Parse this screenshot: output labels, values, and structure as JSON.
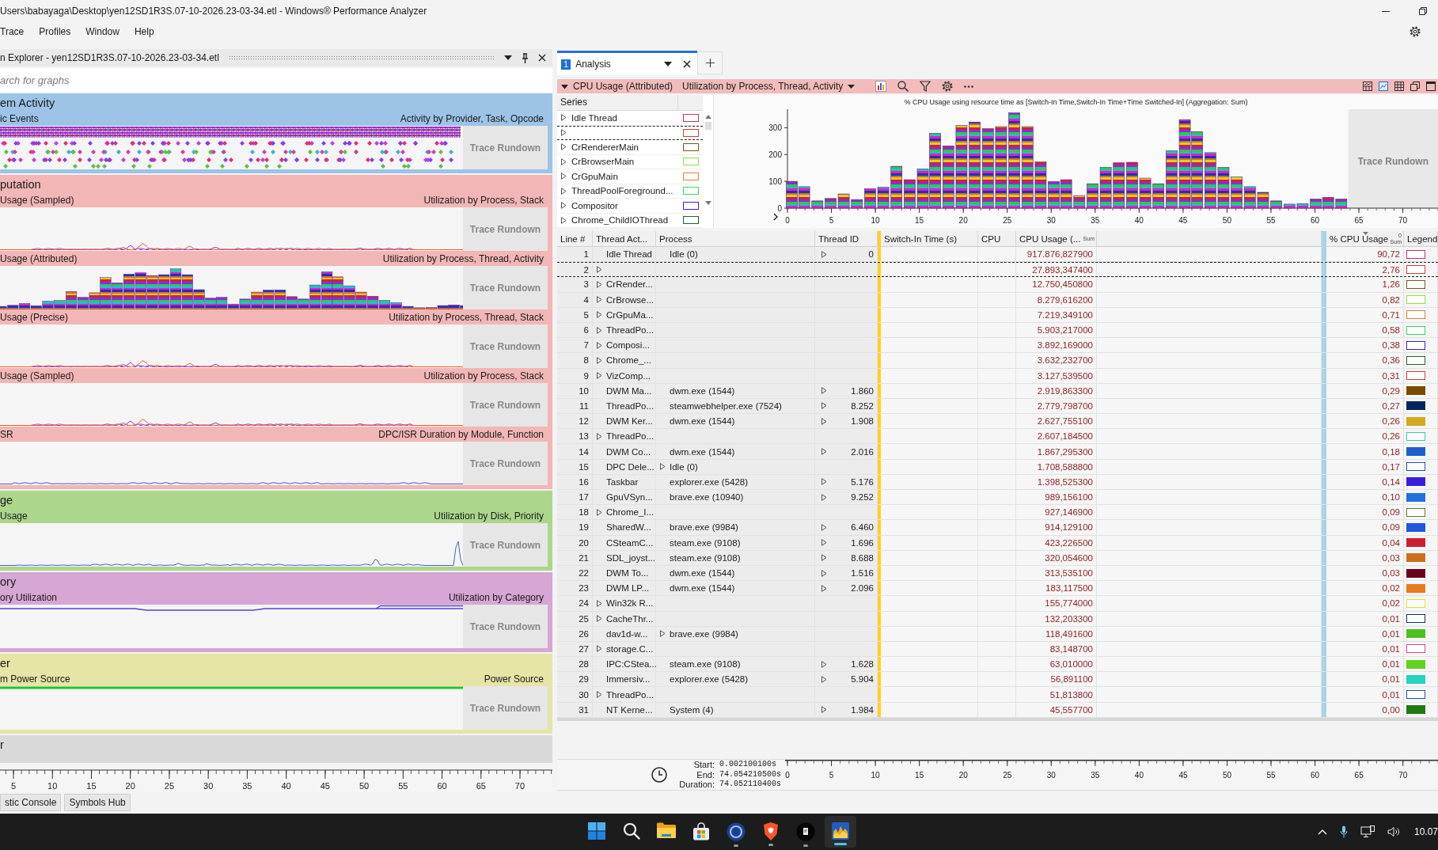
{
  "window": {
    "title": "Users\\babayaga\\Desktop\\yen12SD1R3S.07-10-2026.23-03-34.etl - Windows® Performance Analyzer"
  },
  "menu": [
    "Trace",
    "Profiles",
    "Window",
    "Help"
  ],
  "graph_explorer": {
    "title": "n Explorer - yen12SD1R3S.07-10-2026.23-03-34.etl",
    "search": {
      "placeholder": "arch for graphs"
    },
    "groups": [
      {
        "title": "em Activity",
        "color": "#9dc3e6",
        "graphs": [
          {
            "name": "ic Events",
            "preset": "Activity by Provider, Task, Opcode",
            "kind": "events",
            "rundown": "Trace Rundown"
          }
        ]
      },
      {
        "title": "putation",
        "color": "#f2b6b6",
        "graphs": [
          {
            "name": "Usage (Sampled)",
            "preset": "Utilization by Process, Stack",
            "kind": "lines",
            "rundown": "Trace Rundown"
          },
          {
            "name": "Usage (Attributed)",
            "preset": "Utilization by Process, Thread, Activity",
            "kind": "stacked",
            "rundown": "Trace Rundown"
          },
          {
            "name": "Usage (Precise)",
            "preset": "Utilization by Process, Thread, Stack",
            "kind": "lines",
            "rundown": "Trace Rundown"
          },
          {
            "name": "Usage (Sampled)",
            "preset": "Utilization by Process, Stack",
            "kind": "lines",
            "rundown": "Trace Rundown"
          },
          {
            "name": "SR",
            "preset": "DPC/ISR Duration by Module, Function",
            "kind": "dpc",
            "rundown": "Trace Rundown"
          }
        ]
      },
      {
        "title": "ge",
        "color": "#acd68c",
        "graphs": [
          {
            "name": "Usage",
            "preset": "Utilization by Disk, Priority",
            "kind": "spike",
            "rundown": "Trace Rundown"
          }
        ]
      },
      {
        "title": "ory",
        "color": "#d6a6d4",
        "graphs": [
          {
            "name": "ory Utilization",
            "preset": "Utilization by Category",
            "kind": "flat",
            "rundown": "Trace Rundown"
          }
        ]
      },
      {
        "title": "er",
        "color": "#e6e4a6",
        "graphs": [
          {
            "name": "m Power Source",
            "preset": "Power Source",
            "kind": "power",
            "rundown": "Trace Rundown"
          }
        ]
      },
      {
        "title": "r",
        "color": "#d9d9d9"
      }
    ],
    "timeline_ticks": [
      "5",
      "10",
      "15",
      "20",
      "25",
      "30",
      "35",
      "40",
      "45",
      "50",
      "55",
      "60",
      "65",
      "70"
    ]
  },
  "bottom_tabs": [
    "stic Console",
    "Symbols Hub"
  ],
  "analysis": {
    "tabs": [
      {
        "number": "1",
        "label": "Analysis",
        "selected": true
      }
    ],
    "graph": {
      "title": "CPU Usage (Attributed)",
      "preset": "Utilization by Process, Thread, Activity",
      "expanded": true
    },
    "series_header": "Series",
    "series": [
      {
        "name": "Idle Thread",
        "color": "#c8306a",
        "expanded": false,
        "focused": false
      },
      {
        "color": "#d04030",
        "expanded": false,
        "focused": true
      },
      {
        "name": "CrRendererMain",
        "color": "#7a5a10",
        "expanded": false,
        "focused": false
      },
      {
        "name": "CrBrowserMain",
        "color": "#8ee040",
        "expanded": false,
        "focused": false
      },
      {
        "name": "CrGpuMain",
        "color": "#e0803a",
        "expanded": false,
        "focused": false
      },
      {
        "name": "ThreadPoolForeground...",
        "color": "#30d860",
        "expanded": false,
        "focused": false
      },
      {
        "name": "Compositor",
        "color": "#3a20d8",
        "expanded": false,
        "focused": false
      },
      {
        "name": "Chrome_ChildIOThread",
        "color": "#1e6a1e",
        "expanded": false,
        "focused": false
      }
    ],
    "chart_data": [
      {
        "type": "bar",
        "title": "% CPU Usage using resource time as [Switch-In Time,Switch-In Time+Time Switched-In] (Aggregation: Sum)",
        "x": [
          0.5,
          1.9,
          3.4,
          4.9,
          6.4,
          7.9,
          9.4,
          10.9,
          12.4,
          13.9,
          15.4,
          16.8,
          18.3,
          19.8,
          21.3,
          22.8,
          24.3,
          25.8,
          27.3,
          28.8,
          30.3,
          31.7,
          33.2,
          34.7,
          36.2,
          37.7,
          39.2,
          40.7,
          42.2,
          43.7,
          45.2,
          46.6,
          48.1,
          49.6,
          51.1,
          52.6,
          54.1,
          55.6,
          57.1,
          58.6,
          60.1,
          61.5,
          63.0
        ],
        "values": [
          100,
          80,
          27,
          36,
          53,
          32,
          72,
          78,
          156,
          106,
          146,
          279,
          232,
          309,
          321,
          296,
          304,
          355,
          304,
          173,
          99,
          106,
          47,
          91,
          152,
          169,
          171,
          112,
          91,
          214,
          330,
          285,
          207,
          152,
          116,
          80,
          59,
          27,
          15,
          17,
          34,
          40,
          34
        ],
        "xlim": [
          0,
          74
        ],
        "ylim": [
          0,
          360
        ],
        "xticks": [
          0,
          5,
          10,
          15,
          20,
          25,
          30,
          35,
          40,
          45,
          50,
          55,
          60,
          65,
          70
        ],
        "yticks": [
          0,
          100,
          200,
          300
        ],
        "bands": [
          {
            "axis": "x",
            "from": 63.8,
            "to": 74,
            "label": "Trace Rundown",
            "color": "#e8e8e8"
          }
        ]
      }
    ],
    "table": {
      "columns": [
        {
          "label": "Line #",
          "sorted": false
        },
        {
          "label": "Thread Act...",
          "sorted": false
        },
        {
          "label": "Process",
          "sorted": false
        },
        {
          "label": "Thread ID",
          "sorted": false
        },
        {
          "label": "Switch-In Time (s)",
          "sorted": false
        },
        {
          "label": "CPU",
          "sorted": false
        },
        {
          "label": "CPU Usage (...",
          "aggregation": "Sum",
          "sorted": false
        },
        {
          "label": "% CPU Usage",
          "aggregation": "Sum",
          "sorted": true,
          "sort_priority": "0"
        },
        {
          "label": "Legend",
          "sorted": false
        }
      ],
      "rows": [
        {
          "line": "1",
          "thread": "Idle Thread",
          "process": "Idle (0)",
          "thread_id": "0",
          "cpu_usage": "917.876,827900",
          "percent": "90,72",
          "kind": "thread",
          "expanded": false,
          "focused": false,
          "color": "#c8306a",
          "legend_filled": false
        },
        {
          "line": "2",
          "cpu_usage": "27.893,347400",
          "percent": "2,76",
          "kind": "group",
          "expanded": false,
          "focused": true,
          "color": "#d04030",
          "legend_filled": false
        },
        {
          "line": "3",
          "thread": "CrRender...",
          "cpu_usage": "12.750,450800",
          "percent": "1,26",
          "kind": "group",
          "expanded": false,
          "focused": false,
          "color": "#7a5a10",
          "legend_filled": false
        },
        {
          "line": "4",
          "thread": "CrBrowse...",
          "cpu_usage": "8.279,616200",
          "percent": "0,82",
          "kind": "group",
          "expanded": false,
          "focused": false,
          "color": "#8ee040",
          "legend_filled": false
        },
        {
          "line": "5",
          "thread": "CrGpuMa...",
          "cpu_usage": "7.219,349100",
          "percent": "0,71",
          "kind": "group",
          "expanded": false,
          "focused": false,
          "color": "#e0803a",
          "legend_filled": false
        },
        {
          "line": "6",
          "thread": "ThreadPo...",
          "cpu_usage": "5.903,217000",
          "percent": "0,58",
          "kind": "group",
          "expanded": false,
          "focused": false,
          "color": "#30d860",
          "legend_filled": false
        },
        {
          "line": "7",
          "thread": "Composi...",
          "cpu_usage": "3.892,169000",
          "percent": "0,38",
          "kind": "group",
          "expanded": false,
          "focused": false,
          "color": "#3a20d8",
          "legend_filled": false
        },
        {
          "line": "8",
          "thread": "Chrome_...",
          "cpu_usage": "3.632,232700",
          "percent": "0,36",
          "kind": "group",
          "expanded": false,
          "focused": false,
          "color": "#1e6a1e",
          "legend_filled": false
        },
        {
          "line": "9",
          "thread": "VizComp...",
          "cpu_usage": "3.127,539500",
          "percent": "0,31",
          "kind": "group",
          "expanded": false,
          "focused": false,
          "color": "#e03a3a",
          "legend_filled": false
        },
        {
          "line": "10",
          "thread": "DWM Ma...",
          "process": "dwm.exe (1544)",
          "thread_id": "1.860",
          "cpu_usage": "2.919,863300",
          "percent": "0,29",
          "kind": "thread",
          "expanded": false,
          "focused": false,
          "color": "#7a4a00",
          "legend_filled": true
        },
        {
          "line": "11",
          "thread": "ThreadPo...",
          "process": "steamwebhelper.exe (7524)",
          "thread_id": "8.252",
          "cpu_usage": "2.779,798700",
          "percent": "0,27",
          "kind": "thread",
          "expanded": false,
          "focused": false,
          "color": "#00285e",
          "legend_filled": true
        },
        {
          "line": "12",
          "thread": "DWM Ker...",
          "process": "dwm.exe (1544)",
          "thread_id": "1.908",
          "cpu_usage": "2.627,755100",
          "percent": "0,26",
          "kind": "thread",
          "expanded": false,
          "focused": false,
          "color": "#d4a820",
          "legend_filled": true
        },
        {
          "line": "13",
          "thread": "ThreadPo...",
          "cpu_usage": "2.607,184500",
          "percent": "0,26",
          "kind": "group",
          "expanded": false,
          "focused": false,
          "color": "#30d0a0",
          "legend_filled": false
        },
        {
          "line": "14",
          "thread": "DWM Co...",
          "process": "dwm.exe (1544)",
          "thread_id": "2.016",
          "cpu_usage": "1.867,295300",
          "percent": "0,18",
          "kind": "thread",
          "expanded": false,
          "focused": false,
          "color": "#1e5fd0",
          "legend_filled": true
        },
        {
          "line": "15",
          "thread": "DPC Dele...",
          "process": "Idle (0)",
          "cpu_usage": "1.708,588800",
          "percent": "0,17",
          "kind": "process",
          "expanded": false,
          "focused": false,
          "color": "#1e4fb8",
          "legend_filled": false
        },
        {
          "line": "16",
          "thread": "Taskbar",
          "process": "explorer.exe (5428)",
          "thread_id": "5.176",
          "cpu_usage": "1.398,525300",
          "percent": "0,14",
          "kind": "thread",
          "expanded": false,
          "focused": false,
          "color": "#3a1ee0",
          "legend_filled": true
        },
        {
          "line": "17",
          "thread": "GpuVSyn...",
          "process": "brave.exe (10940)",
          "thread_id": "9.252",
          "cpu_usage": "989,156100",
          "percent": "0,10",
          "kind": "thread",
          "expanded": false,
          "focused": false,
          "color": "#2070e0",
          "legend_filled": true
        },
        {
          "line": "18",
          "thread": "Chrome_I...",
          "cpu_usage": "927,146900",
          "percent": "0,09",
          "kind": "group",
          "expanded": false,
          "focused": false,
          "color": "#5a8020",
          "legend_filled": false
        },
        {
          "line": "19",
          "thread": "SharedW...",
          "process": "brave.exe (9984)",
          "thread_id": "6.460",
          "cpu_usage": "914,129100",
          "percent": "0,09",
          "kind": "thread",
          "expanded": false,
          "focused": false,
          "color": "#2255e0",
          "legend_filled": true
        },
        {
          "line": "20",
          "thread": "CSteamC...",
          "process": "steam.exe (9108)",
          "thread_id": "1.696",
          "cpu_usage": "423,226500",
          "percent": "0,04",
          "kind": "thread",
          "expanded": false,
          "focused": false,
          "color": "#d01e30",
          "legend_filled": true
        },
        {
          "line": "21",
          "thread": "SDL_joyst...",
          "process": "steam.exe (9108)",
          "thread_id": "8.688",
          "cpu_usage": "320,054600",
          "percent": "0,03",
          "kind": "thread",
          "expanded": false,
          "focused": false,
          "color": "#cc6e1e",
          "legend_filled": true
        },
        {
          "line": "22",
          "thread": "DWM To...",
          "process": "dwm.exe (1544)",
          "thread_id": "1.516",
          "cpu_usage": "313,535100",
          "percent": "0,03",
          "kind": "thread",
          "expanded": false,
          "focused": false,
          "color": "#6a0020",
          "legend_filled": true
        },
        {
          "line": "23",
          "thread": "DWM LP...",
          "process": "dwm.exe (1544)",
          "thread_id": "2.096",
          "cpu_usage": "183,117500",
          "percent": "0,02",
          "kind": "thread",
          "expanded": false,
          "focused": false,
          "color": "#e87a20",
          "legend_filled": true
        },
        {
          "line": "24",
          "thread": "Win32k R...",
          "cpu_usage": "155,774000",
          "percent": "0,02",
          "kind": "group",
          "expanded": false,
          "focused": false,
          "color": "#e0e030",
          "legend_filled": false
        },
        {
          "line": "25",
          "thread": "CacheThr...",
          "cpu_usage": "132,203300",
          "percent": "0,01",
          "kind": "group",
          "expanded": false,
          "focused": false,
          "color": "#10305e",
          "legend_filled": false
        },
        {
          "line": "26",
          "thread": "dav1d-w...",
          "process": "brave.exe (9984)",
          "cpu_usage": "118,491600",
          "percent": "0,01",
          "kind": "process",
          "expanded": false,
          "focused": false,
          "color": "#4cc21e",
          "legend_filled": true
        },
        {
          "line": "27",
          "thread": "storage.C...",
          "cpu_usage": "83,148700",
          "percent": "0,01",
          "kind": "group",
          "expanded": false,
          "focused": false,
          "color": "#e0409a",
          "legend_filled": false
        },
        {
          "line": "28",
          "thread": "IPC:CStea...",
          "process": "steam.exe (9108)",
          "thread_id": "1.628",
          "cpu_usage": "63,010000",
          "percent": "0,01",
          "kind": "thread",
          "expanded": false,
          "focused": false,
          "color": "#62d21e",
          "legend_filled": true
        },
        {
          "line": "29",
          "thread": "Immersiv...",
          "process": "explorer.exe (5428)",
          "thread_id": "5.904",
          "cpu_usage": "56,891100",
          "percent": "0,01",
          "kind": "thread",
          "expanded": false,
          "focused": false,
          "color": "#22d4c0",
          "legend_filled": true
        },
        {
          "line": "30",
          "thread": "ThreadPo...",
          "cpu_usage": "51,813800",
          "percent": "0,01",
          "kind": "group",
          "expanded": false,
          "focused": false,
          "color": "#1e50c0",
          "legend_filled": false
        },
        {
          "line": "31",
          "thread": "NT Kerne...",
          "process": "System (4)",
          "thread_id": "1.984",
          "cpu_usage": "45,557700",
          "percent": "0,00",
          "kind": "thread",
          "expanded": false,
          "focused": false,
          "color": "#1e7a10",
          "legend_filled": true
        }
      ]
    },
    "time_range": {
      "rows": [
        {
          "label": "Start:",
          "value": "0.002100100s"
        },
        {
          "label": "End:",
          "value": "74.054210500s"
        },
        {
          "label": "Duration:",
          "value": "74.052110400s"
        }
      ],
      "ticks": [
        "0",
        "5",
        "10",
        "15",
        "20",
        "25",
        "30",
        "35",
        "40",
        "45",
        "50",
        "55",
        "60",
        "65",
        "70"
      ]
    }
  },
  "taskbar": {
    "apps": [
      {
        "kind": "start",
        "selected": false,
        "running": false
      },
      {
        "kind": "search",
        "selected": false,
        "running": false
      },
      {
        "kind": "files",
        "selected": false,
        "running": false
      },
      {
        "kind": "store",
        "selected": false,
        "running": false
      },
      {
        "kind": "ring",
        "selected": false,
        "running": true
      },
      {
        "kind": "shield",
        "selected": false,
        "running": true
      },
      {
        "kind": "dark",
        "selected": false,
        "running": true
      },
      {
        "kind": "analyzer",
        "selected": true,
        "running": true
      }
    ],
    "clock": "10.07"
  }
}
